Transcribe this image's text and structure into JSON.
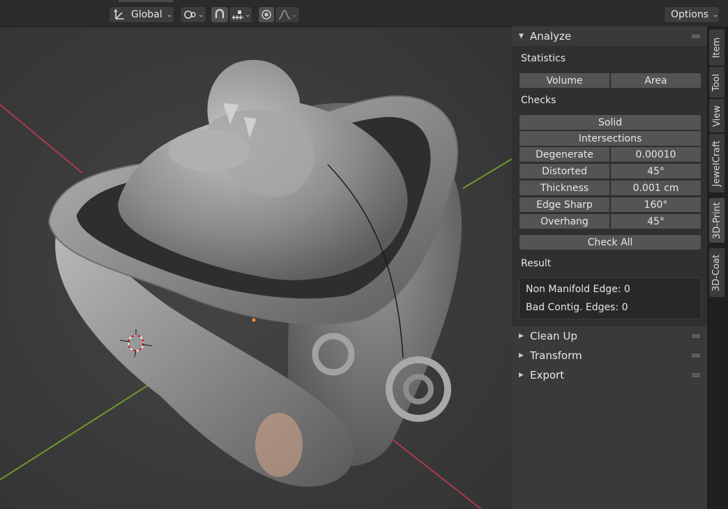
{
  "header": {
    "orientation": "Global",
    "options_label": "Options"
  },
  "analyze": {
    "title": "Analyze",
    "statistics_label": "Statistics",
    "volume_label": "Volume",
    "area_label": "Area",
    "checks_label": "Checks",
    "solid_label": "Solid",
    "intersections_label": "Intersections",
    "checks": [
      {
        "label": "Degenerate",
        "value": "0.00010"
      },
      {
        "label": "Distorted",
        "value": "45°"
      },
      {
        "label": "Thickness",
        "value": "0.001 cm"
      },
      {
        "label": "Edge Sharp",
        "value": "160°"
      },
      {
        "label": "Overhang",
        "value": "45°"
      }
    ],
    "check_all_label": "Check All",
    "result_label": "Result",
    "results": [
      "Non Manifold Edge: 0",
      "Bad Contig. Edges: 0"
    ]
  },
  "panels": [
    "Clean Up",
    "Transform",
    "Export"
  ],
  "tabs": [
    "Item",
    "Tool",
    "View",
    "JewelCraft",
    "3D-Print",
    "3D-Coat"
  ],
  "active_tab": "3D-Print",
  "colors": {
    "x_axis": "#b03a48",
    "y_axis": "#6f9a2a",
    "model": "#8e8e8e",
    "panel_bg": "#303030"
  }
}
